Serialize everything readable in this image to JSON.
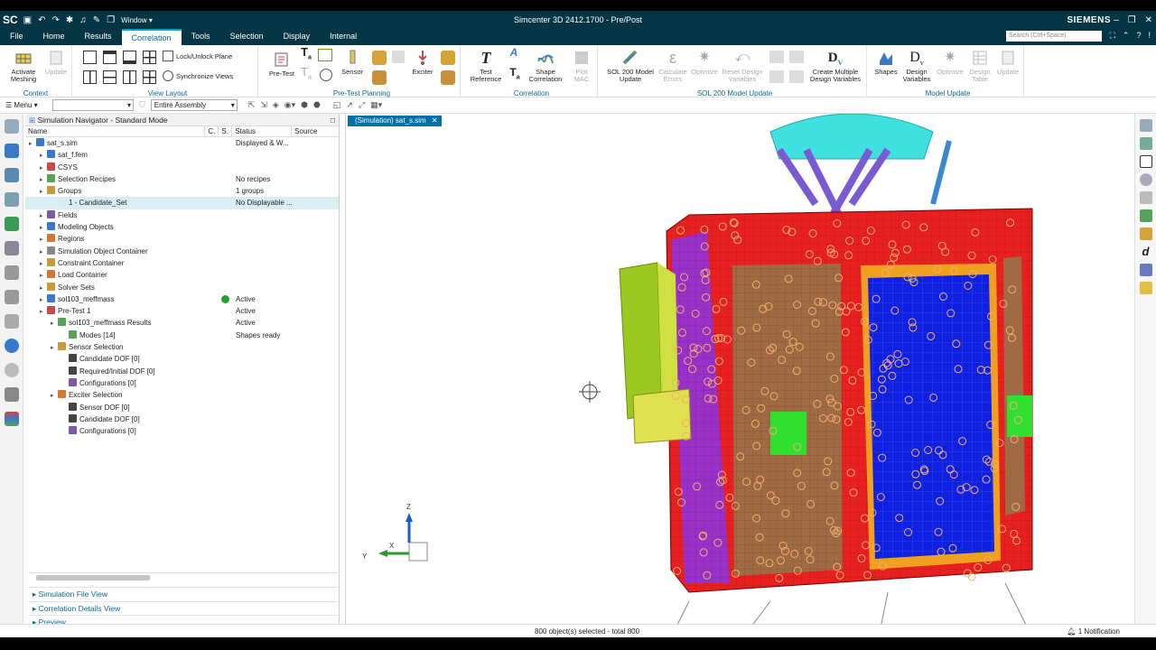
{
  "app": {
    "logo": "SC",
    "window_menu": "Window",
    "title": "Simcenter 3D 2412.1700 - Pre/Post",
    "brand": "SIEMENS",
    "search_placeholder": "Search (Ctrl+Space)"
  },
  "menu_tabs": [
    "File",
    "Home",
    "Results",
    "Correlation",
    "Tools",
    "Selection",
    "Display",
    "Internal"
  ],
  "active_tab": "Correlation",
  "ribbon": {
    "groups": {
      "context": "Context",
      "view_layout": "View Layout",
      "pretest_planning": "Pre-Test Planning",
      "correlation": "Correlation",
      "sol200": "SOL 200 Model Update",
      "model_update": "Model Update"
    },
    "buttons": {
      "activate_meshing": "Activate Meshing",
      "update": "Update",
      "lock_unlock_plane": "Lock/Unlock Plane",
      "sync_views": "Synchronize Views",
      "pretest": "Pre-Test",
      "sensor": "Sensor",
      "exciter": "Exciter",
      "test_reference": "Test Reference",
      "shape_correlation": "Shape Correlation",
      "plot_mac": "Plot MAC",
      "sol200_model_update": "SOL 200 Model Update",
      "calculate_errors": "Calculate Errors",
      "optimize": "Optimize",
      "reset_design_variables": "Reset Design Variables",
      "create_multiple_design_variables": "Create Multiple Design Variables",
      "shapes": "Shapes",
      "design_variables": "Design Variables",
      "optimize2": "Optimize",
      "design_table": "Design Table",
      "update2": "Update"
    }
  },
  "toolbar": {
    "menu": "Menu",
    "filter": "Entire Assembly"
  },
  "navigator": {
    "title": "Simulation Navigator - Standard Mode",
    "columns": [
      "Name",
      "C.",
      "S.",
      "Status",
      "Source"
    ],
    "rows": [
      {
        "name": "sat_s.sim",
        "status": "Displayed & W...",
        "depth": 0,
        "color": "#3a78c8"
      },
      {
        "name": "sat_f.fem",
        "status": "",
        "depth": 1,
        "color": "#3a78c8"
      },
      {
        "name": "CSYS",
        "status": "",
        "depth": 1,
        "color": "#c84a4a"
      },
      {
        "name": "Selection Recipes",
        "status": "No recipes",
        "depth": 1,
        "color": "#5aa05a"
      },
      {
        "name": "Groups",
        "status": "1 groups",
        "depth": 1,
        "color": "#c89a3a"
      },
      {
        "name": "1 - Candidate_Set",
        "status": "No Displayable ...",
        "depth": 2,
        "color": "#d6ecf2",
        "selected": true
      },
      {
        "name": "Fields",
        "status": "",
        "depth": 1,
        "color": "#7a5aa0"
      },
      {
        "name": "Modeling Objects",
        "status": "",
        "depth": 1,
        "color": "#3a78c8"
      },
      {
        "name": "Regions",
        "status": "",
        "depth": 1,
        "color": "#d07a3a"
      },
      {
        "name": "Simulation Object Container",
        "status": "",
        "depth": 1,
        "color": "#888888"
      },
      {
        "name": "Constraint Container",
        "status": "",
        "depth": 1,
        "color": "#c89a3a"
      },
      {
        "name": "Load Container",
        "status": "",
        "depth": 1,
        "color": "#d07a3a"
      },
      {
        "name": "Solver Sets",
        "status": "",
        "depth": 1,
        "color": "#c89a3a"
      },
      {
        "name": "sol103_meffmass",
        "status": "Active",
        "depth": 1,
        "color": "#3a78c8",
        "dot": true
      },
      {
        "name": "Pre-Test 1",
        "status": "Active",
        "depth": 1,
        "color": "#c84a4a"
      },
      {
        "name": "sol103_meffmass Results",
        "status": "Active",
        "depth": 2,
        "color": "#5aa05a"
      },
      {
        "name": "Modes [14]",
        "status": "Shapes ready",
        "depth": 3,
        "color": "#5aa05a"
      },
      {
        "name": "Sensor Selection",
        "status": "",
        "depth": 2,
        "color": "#c89a3a"
      },
      {
        "name": "Candidate DOF [0]",
        "status": "",
        "depth": 3,
        "color": "#444444"
      },
      {
        "name": "Required/Initial DOF [0]",
        "status": "",
        "depth": 3,
        "color": "#444444"
      },
      {
        "name": "Configurations [0]",
        "status": "",
        "depth": 3,
        "color": "#7a5aa0"
      },
      {
        "name": "Exciter Selection",
        "status": "",
        "depth": 2,
        "color": "#d07a3a"
      },
      {
        "name": "Sensor DOF [0]",
        "status": "",
        "depth": 3,
        "color": "#444444"
      },
      {
        "name": "Candidate DOF [0]",
        "status": "",
        "depth": 3,
        "color": "#444444"
      },
      {
        "name": "Configurations [0]",
        "status": "",
        "depth": 3,
        "color": "#7a5aa0"
      }
    ],
    "panels": [
      "Simulation File View",
      "Correlation Details View",
      "Preview"
    ]
  },
  "viewport": {
    "tab": "(Simulation) sat_s.sim",
    "axis_z": "Z",
    "axis_x": "X",
    "axis_y": "Y"
  },
  "status": {
    "selection": "800 object(s) selected - total 800",
    "notification": "1 Notification"
  },
  "colors": {
    "titlebar": "#033544",
    "accent": "#0c6a8c",
    "tab": "#006fa6"
  }
}
